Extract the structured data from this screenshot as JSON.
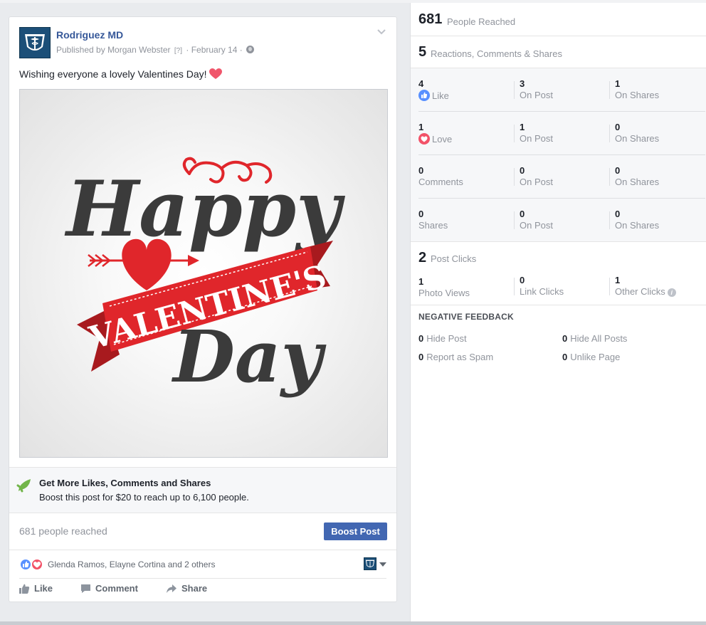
{
  "post": {
    "page_name": "Rodriguez MD",
    "published_prefix": "Published by",
    "publisher": "Morgan Webster",
    "publisher_help": "[?]",
    "date": "February 14",
    "message": "Wishing everyone a lovely Valentines Day!",
    "image": {
      "line1": "Happy",
      "line2": "VALENTINE'S",
      "line3": "Day"
    },
    "boost_title": "Get More Likes, Comments and Shares",
    "boost_subtitle": "Boost this post for $20 to reach up to 6,100 people.",
    "reached_text": "681 people reached",
    "boost_button": "Boost Post",
    "reactors_text": "Glenda Ramos, Elayne Cortina and 2 others",
    "actions": {
      "like": "Like",
      "comment": "Comment",
      "share": "Share"
    }
  },
  "insights": {
    "reach": {
      "value": "681",
      "label": "People Reached"
    },
    "engagement": {
      "value": "5",
      "label": "Reactions, Comments & Shares"
    },
    "rows": [
      {
        "total": "4",
        "total_label": "Like",
        "icon": "like-icon",
        "on_post": "3",
        "on_post_label": "On Post",
        "on_shares": "1",
        "on_shares_label": "On Shares"
      },
      {
        "total": "1",
        "total_label": "Love",
        "icon": "love-icon",
        "on_post": "1",
        "on_post_label": "On Post",
        "on_shares": "0",
        "on_shares_label": "On Shares"
      },
      {
        "total": "0",
        "total_label": "Comments",
        "on_post": "0",
        "on_post_label": "On Post",
        "on_shares": "0",
        "on_shares_label": "On Shares"
      },
      {
        "total": "0",
        "total_label": "Shares",
        "on_post": "0",
        "on_post_label": "On Post",
        "on_shares": "0",
        "on_shares_label": "On Shares"
      }
    ],
    "clicks": {
      "value": "2",
      "label": "Post Clicks",
      "photo_views": "1",
      "photo_views_label": "Photo Views",
      "link_clicks": "0",
      "link_clicks_label": "Link Clicks",
      "other_clicks": "1",
      "other_clicks_label": "Other Clicks"
    },
    "negative": {
      "title": "NEGATIVE FEEDBACK",
      "hide_post": "0",
      "hide_post_label": "Hide Post",
      "hide_all": "0",
      "hide_all_label": "Hide All Posts",
      "spam": "0",
      "spam_label": "Report as Spam",
      "unlike": "0",
      "unlike_label": "Unlike Page"
    }
  },
  "colors": {
    "link_blue": "#365899",
    "button_blue": "#4267b2",
    "like_blue": "#5890ff",
    "love_red": "#f25268",
    "valentine_red": "#e0262b",
    "muted_text": "#90949c"
  }
}
